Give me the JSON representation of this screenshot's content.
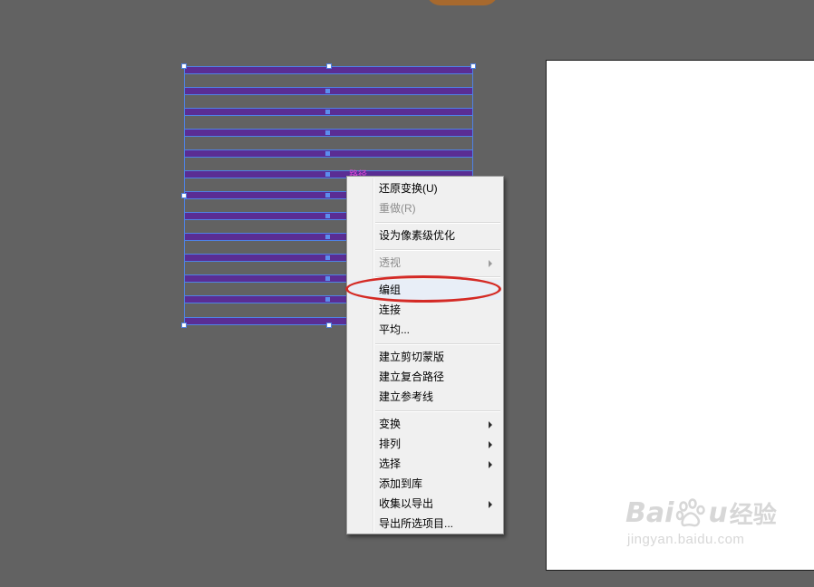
{
  "colors": {
    "canvas_bg": "#626262",
    "bar_fill": "#5a2d94",
    "selection": "#4f82e4",
    "highlight_ellipse": "#d42a25"
  },
  "canvas": {
    "path_hint": "路径"
  },
  "context_menu": {
    "items": [
      {
        "label": "还原变换(U)",
        "disabled": false,
        "submenu": false
      },
      {
        "label": "重做(R)",
        "disabled": true,
        "submenu": false
      },
      {
        "label": "设为像素级优化",
        "disabled": false,
        "submenu": false
      },
      {
        "label": "透视",
        "disabled": true,
        "submenu": true
      },
      {
        "label": "编组",
        "disabled": false,
        "submenu": false,
        "highlighted": true
      },
      {
        "label": "连接",
        "disabled": false,
        "submenu": false
      },
      {
        "label": "平均...",
        "disabled": false,
        "submenu": false
      },
      {
        "label": "建立剪切蒙版",
        "disabled": false,
        "submenu": false
      },
      {
        "label": "建立复合路径",
        "disabled": false,
        "submenu": false
      },
      {
        "label": "建立参考线",
        "disabled": false,
        "submenu": false
      },
      {
        "label": "变换",
        "disabled": false,
        "submenu": true
      },
      {
        "label": "排列",
        "disabled": false,
        "submenu": true
      },
      {
        "label": "选择",
        "disabled": false,
        "submenu": true
      },
      {
        "label": "添加到库",
        "disabled": false,
        "submenu": false
      },
      {
        "label": "收集以导出",
        "disabled": false,
        "submenu": true
      },
      {
        "label": "导出所选项目...",
        "disabled": false,
        "submenu": false
      }
    ]
  },
  "watermark": {
    "brand_latin": "Bai",
    "brand_latin_end": "u",
    "brand_cn": "经验",
    "url": "jingyan.baidu.com"
  }
}
